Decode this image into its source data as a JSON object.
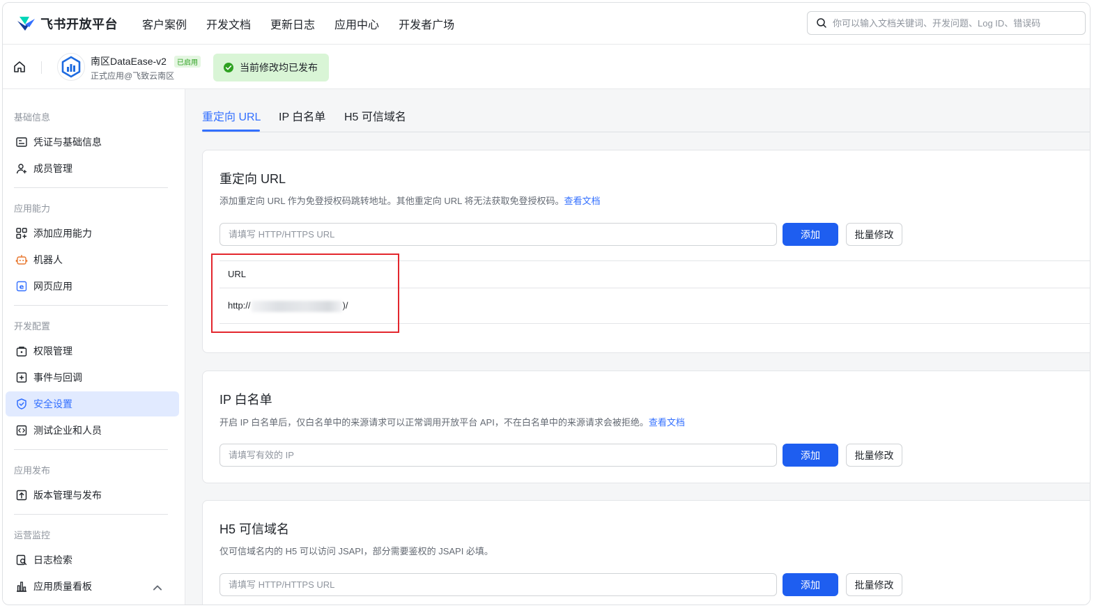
{
  "topnav": {
    "brand": "飞书开放平台",
    "items": [
      "客户案例",
      "开发文档",
      "更新日志",
      "应用中心",
      "开发者广场"
    ],
    "search_placeholder": "你可以输入文档关键词、开发问题、Log ID、错误码"
  },
  "appbar": {
    "app_name": "南区DataEase-v2",
    "badge": "已启用",
    "subtitle": "正式应用@飞致云南区",
    "publish_status": "当前修改均已发布"
  },
  "sidebar": {
    "sections": [
      {
        "title": "基础信息",
        "items": [
          "凭证与基础信息",
          "成员管理"
        ]
      },
      {
        "title": "应用能力",
        "items": [
          "添加应用能力",
          "机器人",
          "网页应用"
        ]
      },
      {
        "title": "开发配置",
        "items": [
          "权限管理",
          "事件与回调",
          "安全设置",
          "测试企业和人员"
        ]
      },
      {
        "title": "应用发布",
        "items": [
          "版本管理与发布"
        ]
      },
      {
        "title": "运营监控",
        "items": [
          "日志检索",
          "应用质量看板"
        ]
      }
    ],
    "active_item": "安全设置"
  },
  "tabs": [
    "重定向 URL",
    "IP 白名单",
    "H5 可信域名"
  ],
  "redirect": {
    "title": "重定向 URL",
    "desc": "添加重定向 URL 作为免登授权码跳转地址。其他重定向 URL 将无法获取免登授权码。",
    "doc_link": "查看文档",
    "placeholder": "请填写 HTTP/HTTPS URL",
    "add": "添加",
    "batch": "批量修改",
    "table_header": "URL",
    "url_prefix": "http://",
    "url_suffix": ")/"
  },
  "ip": {
    "title": "IP 白名单",
    "desc": "开启 IP 白名单后，仅白名单中的来源请求可以正常调用开放平台 API，不在白名单中的来源请求会被拒绝。",
    "doc_link": "查看文档",
    "placeholder": "请填写有效的 IP",
    "add": "添加",
    "batch": "批量修改"
  },
  "h5": {
    "title": "H5 可信域名",
    "desc": "仅可信域名内的 H5 可以访问 JSAPI，部分需要鉴权的 JSAPI 必填。",
    "placeholder": "请填写 HTTP/HTTPS URL",
    "add": "添加",
    "batch": "批量修改"
  },
  "colors": {
    "accent": "#3370ff",
    "primary_button": "#1e5ef0",
    "success_bg": "#d9f5d6",
    "highlight_border": "#e3262d"
  }
}
